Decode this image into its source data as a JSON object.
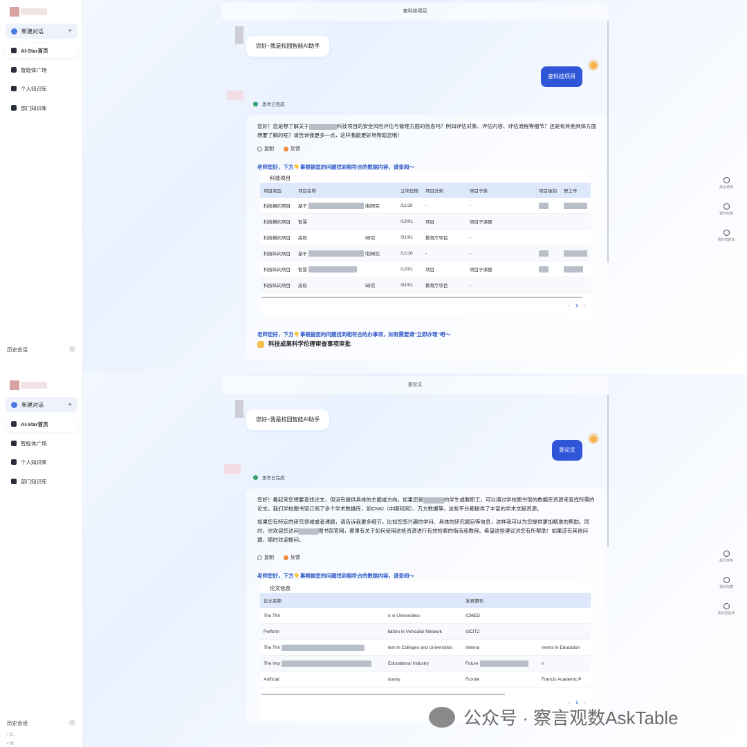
{
  "sidebar": {
    "new_chat": "新建对话",
    "plus": "+",
    "items": [
      "AI-Star首页",
      "智能体广场",
      "个人知识库",
      "部门知识库"
    ],
    "history_title": "历史会话",
    "history_items_bottom": [
      "红",
      "体"
    ]
  },
  "right_rail": [
    "最近使用",
    "我的收藏",
    "我的智能体"
  ],
  "greeting": "您好~我是校园智能AI助手",
  "thinking_label": "思考已完成",
  "actions": {
    "copy": "复制",
    "feedback": "反馈"
  },
  "panel1": {
    "title": "查科技项目",
    "user_query": "查科技项目",
    "answer_parts": [
      "您好！您是想了解关于",
      "科技项目的安全风险评估与管理方面的信息吗？例如评估对象、评估内容、评估流程等细节？还是有其他具体方面想要了解的呢？请告诉我更多一点，这样我能更好地帮助您哦！"
    ],
    "hint": "老师您好，下方👇事根据您的问题找到相符合的数据内容，请查阅～",
    "table_title": "科技项目",
    "headers": [
      "项目类型",
      "项目名称",
      "立项日期",
      "项目分类",
      "项目子类",
      "项目级别",
      "职工号"
    ],
    "rows": [
      [
        "科技横向项目",
        "基于",
        "/11/10",
        "-",
        "-",
        "",
        ""
      ],
      [
        "科技横向项目",
        "智慧",
        "/12/01",
        "项目",
        "项目子课题",
        "",
        ""
      ],
      [
        "科技横向项目",
        "高校",
        "/01/01",
        "教育厅项目",
        "-",
        "",
        ""
      ],
      [
        "科技纵向项目",
        "基于",
        "/11/10",
        "-",
        "-",
        "",
        ""
      ],
      [
        "科技纵向项目",
        "智慧",
        "/12/01",
        "项目",
        "项目子课题",
        "",
        ""
      ],
      [
        "科技纵向项目",
        "高校",
        "/01/01",
        "教育厅项目",
        "-",
        "",
        ""
      ]
    ],
    "row_frag": [
      "\\制研究",
      "",
      "\\研究",
      "\\制研究",
      "",
      "\\研究"
    ],
    "page": "1",
    "hint2": "老师您好，下方👇事根据您的问题找到相符合的办事项，如有需要请\"立即办理\"吧～",
    "affair": "科技成果科学伦理审查事项审批"
  },
  "panel2": {
    "title": "查论文",
    "user_query": "查论文",
    "answer_parts": [
      "您好！看起来您想要查找论文，但没有提供具体的主题或方向。如果您是",
      "的学生或教职工，可以通过学校图书馆的数据库资源来查找所需的论文。我们学校图书馆订阅了多个学术数据库，如CNKI（中国知网）、万方数据等，这些平台都提供了丰富的学术文献资源。",
      "如果您有特定的研究领域或者课题，请告诉我更多细节，比如您感兴趣的学科、具体的研究题目等信息，这样我可以为您提供更加精准的帮助。同时，也欢迎您访问",
      "图书馆官网，那里有关于如何使用这些资源进行有效检索的指南和教程。希望这些建议对您有所帮助！如果还有其他问题，随时欢迎提问。"
    ],
    "hint": "老师您好，下方👇事根据您的问题找到相符合的数据内容，请查阅～",
    "table_title": "论文信息",
    "headers": [
      "论文名称",
      "发表期刊"
    ],
    "rows": [
      [
        "The Thir",
        "n in Universities",
        "ICMED",
        ""
      ],
      [
        "Perform",
        "llation in Vehicular Network",
        "ISCIT2",
        ""
      ],
      [
        "The Thir",
        "tem in Colleges and Universities",
        "Interna",
        "ments in Education"
      ],
      [
        "The Imp",
        "Educational Industry",
        "Future",
        "n"
      ],
      [
        "Artificial",
        "dustry",
        "Frontie",
        "Francis Academic P"
      ]
    ],
    "page": "1"
  },
  "watermark": "公众号 · 察言观数AskTable"
}
